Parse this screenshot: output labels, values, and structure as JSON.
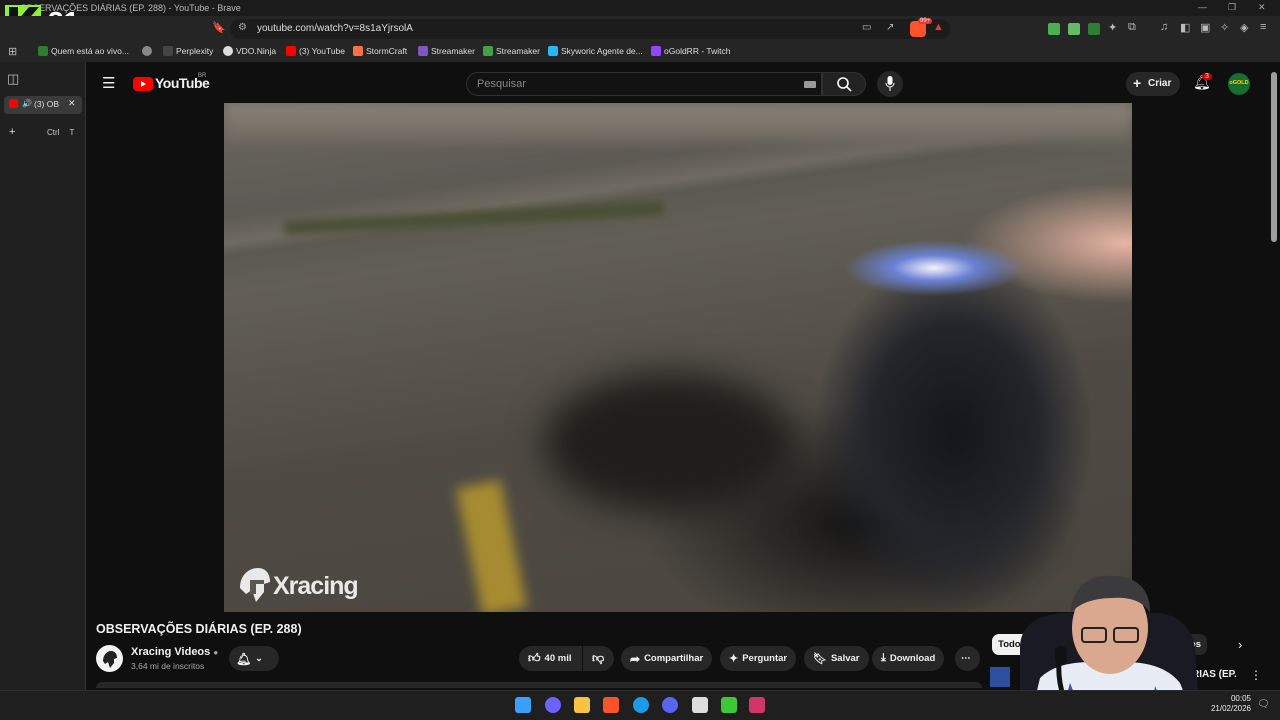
{
  "browser": {
    "window_title": "OBSERVAÇÕES DIÁRIAS (EP. 288) - YouTube - Brave",
    "url": "youtube.com/watch?v=8s1aYjrsolA",
    "brave_badge": "99+",
    "bookmarks": [
      {
        "label": "Quem está ao vivo...",
        "color": "#2e7d32"
      },
      {
        "label": "Perplexity",
        "color": "#888888"
      },
      {
        "label": "VDO.Ninja",
        "color": "#dddddd"
      },
      {
        "label": "(3) YouTube",
        "color": "#ff0000"
      },
      {
        "label": "StormCraft",
        "color": "#ff7043"
      },
      {
        "label": "Streamaker",
        "color": "#7e57c2"
      },
      {
        "label": "Streamaker",
        "color": "#43a047"
      },
      {
        "label": "Skyworic Agente de...",
        "color": "#29b6f6"
      },
      {
        "label": "oGoldRR - Twitch",
        "color": "#9146ff"
      }
    ],
    "sidebar_tab": "(3) OB",
    "new_tab_label": "+",
    "new_tab_shortcut": "Ctrl T",
    "stream_overlay": "31"
  },
  "youtube": {
    "logo_text": "YouTube",
    "region": "BR",
    "search_placeholder": "Pesquisar",
    "create_label": "Criar",
    "notification_count": "3",
    "avatar_text": "oGOLD",
    "video_title": "OBSERVAÇÕES DIÁRIAS (EP. 288)",
    "watermark": "Xracing",
    "channel_name": "Xracing Videos",
    "subscribers": "3,64 mi de inscritos",
    "like_count": "40 mil",
    "share_label": "Compartilhar",
    "ask_label": "Perguntar",
    "save_label": "Salvar",
    "download_label": "Download",
    "chips": [
      "Todos",
      "acionados"
    ],
    "related_title": "IÁRIAS (EP."
  },
  "taskbar": {
    "time": "00:05",
    "date": "21/02/2026"
  },
  "colors": {
    "yt_red": "#ff0000",
    "brave_orange": "#fb542b",
    "k31_green": "#8ef03a"
  }
}
